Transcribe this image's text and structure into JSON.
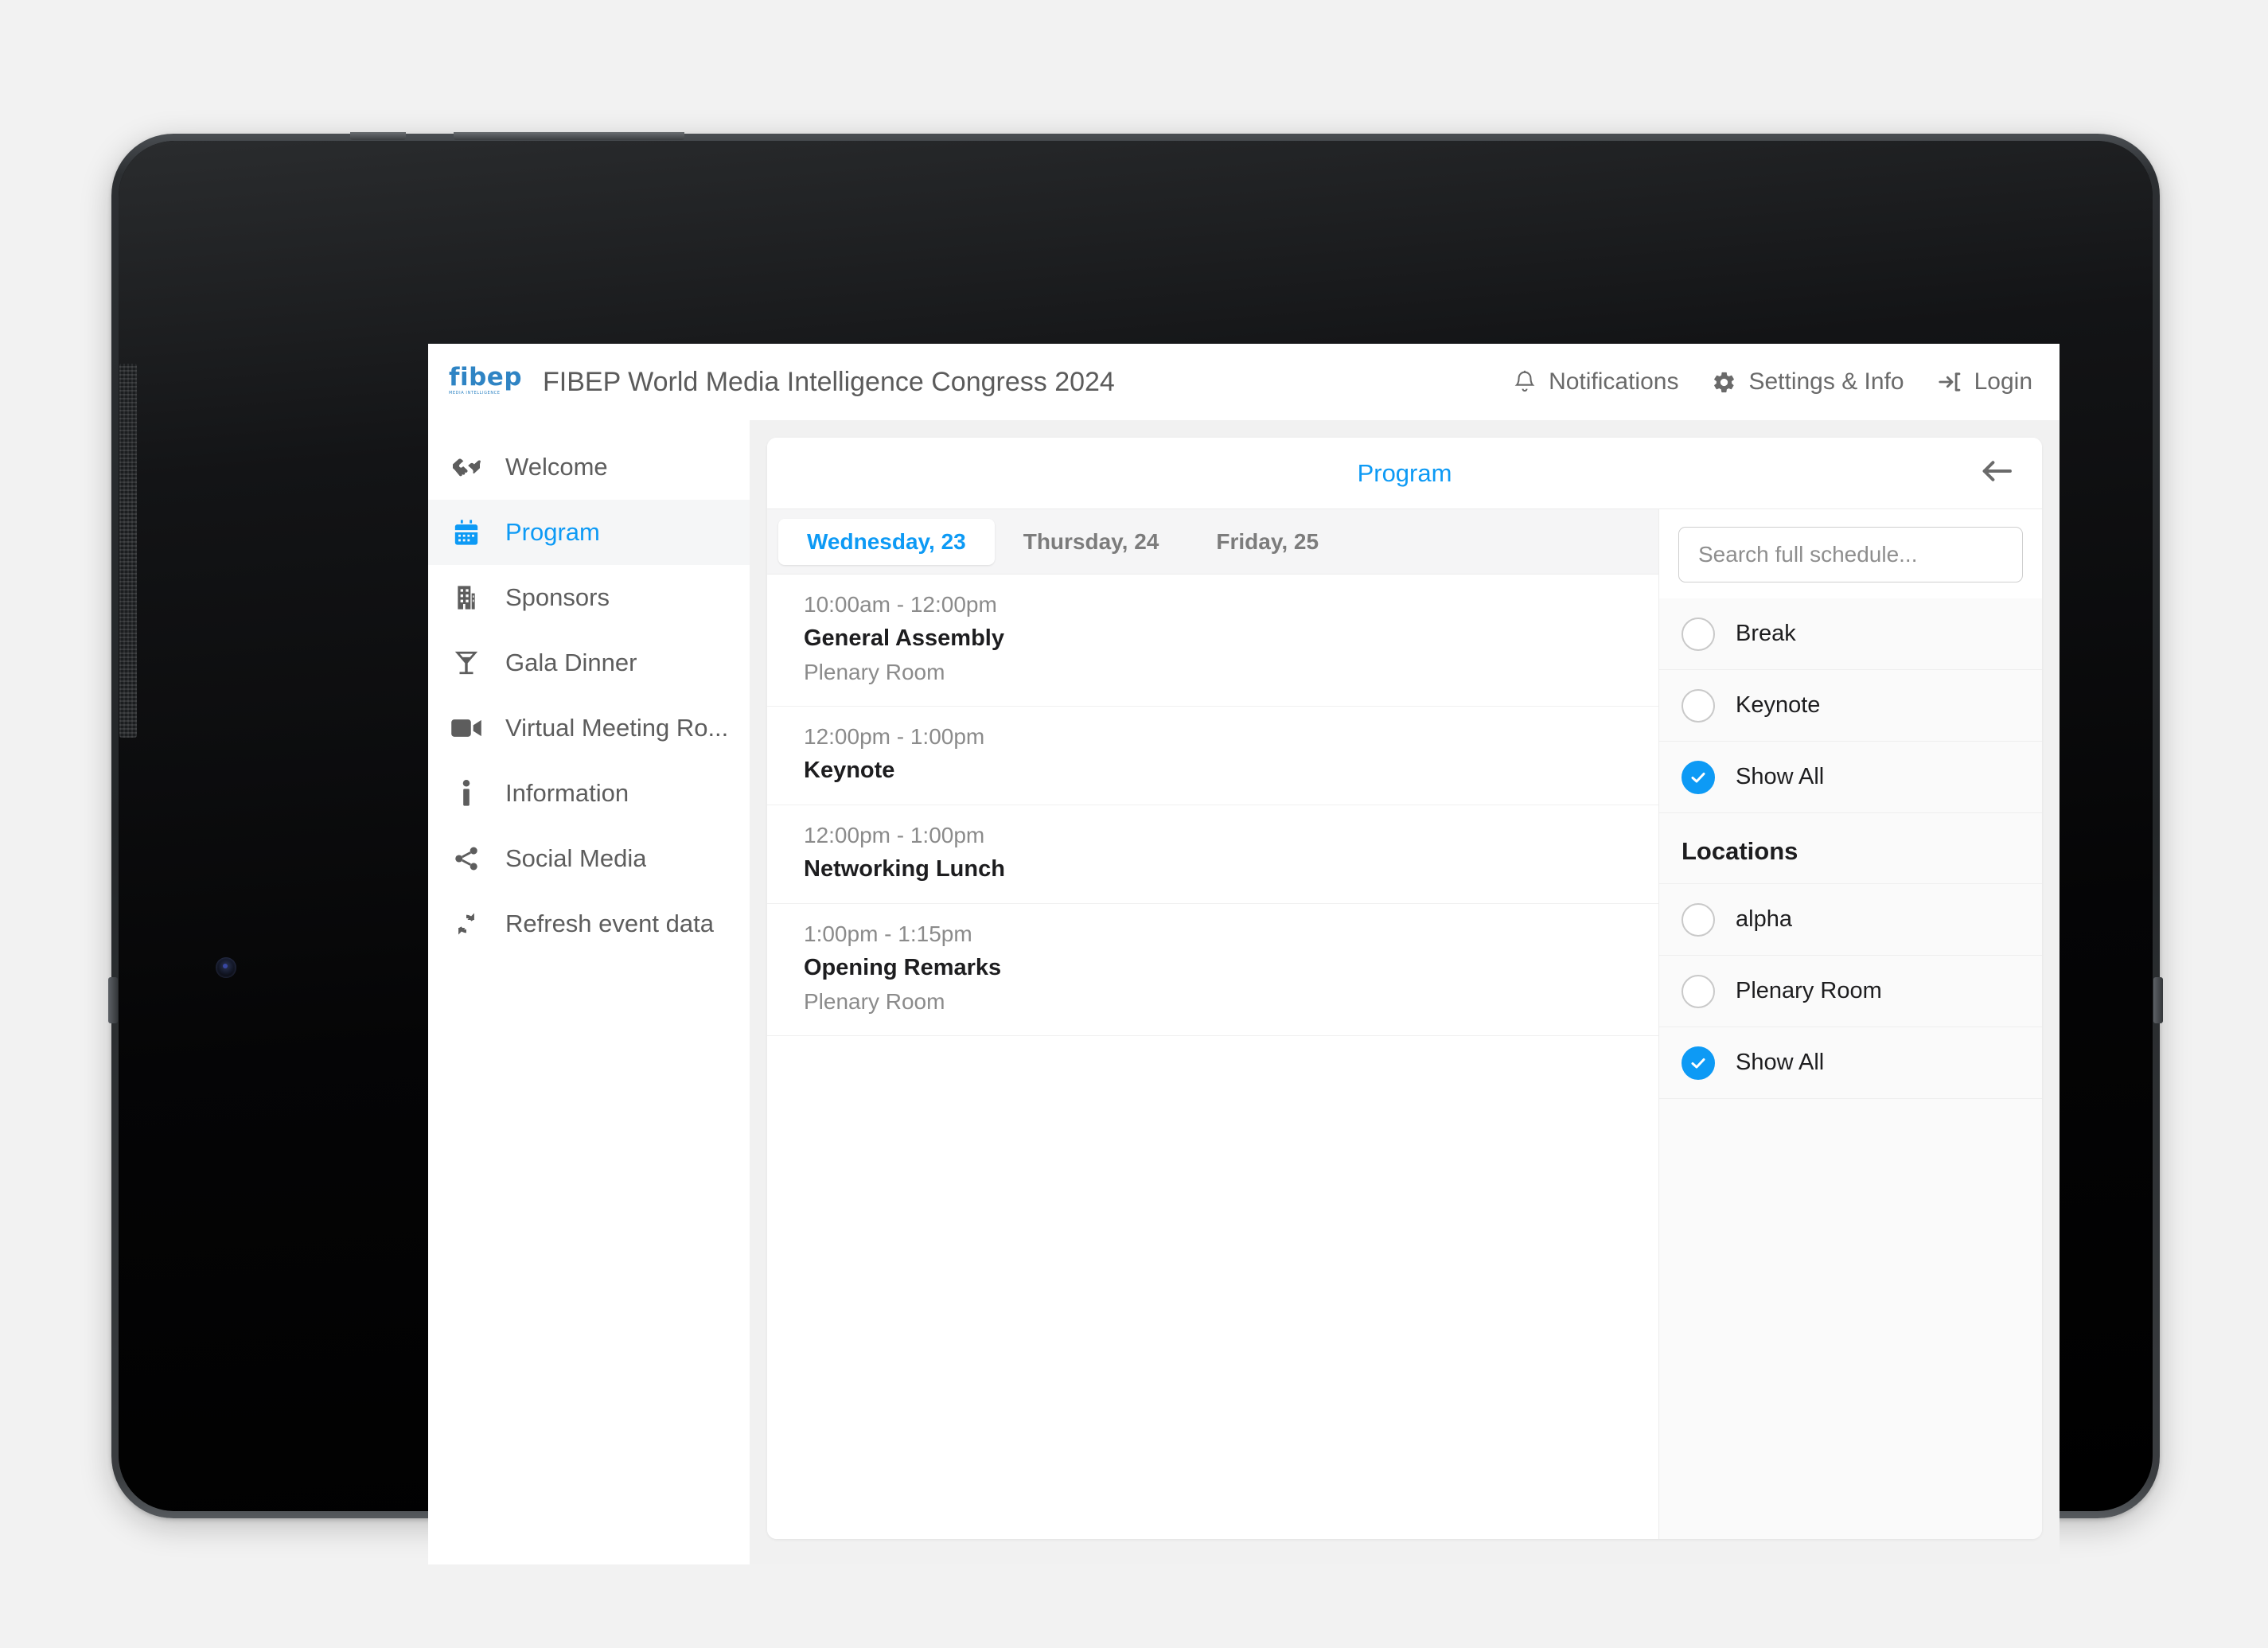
{
  "app": {
    "brand": {
      "logo_text": "fibep",
      "logo_tagline": "MEDIA INTELLIGENCE",
      "logo_color": "#2f84c4"
    },
    "title": "FIBEP World Media Intelligence Congress 2024",
    "accent_color": "#0d9af5"
  },
  "header_actions": [
    {
      "label": "Notifications",
      "icon": "bell-icon"
    },
    {
      "label": "Settings & Info",
      "icon": "gear-icon"
    },
    {
      "label": "Login",
      "icon": "login-arrow-icon"
    }
  ],
  "sidebar": {
    "items": [
      {
        "label": "Welcome",
        "icon": "handshake-icon",
        "active": false
      },
      {
        "label": "Program",
        "icon": "calendar-icon",
        "active": true
      },
      {
        "label": "Sponsors",
        "icon": "building-icon",
        "active": false
      },
      {
        "label": "Gala Dinner",
        "icon": "cocktail-glass-icon",
        "active": false
      },
      {
        "label": "Virtual Meeting Ro...",
        "icon": "video-camera-icon",
        "active": false
      },
      {
        "label": "Information",
        "icon": "info-icon",
        "active": false
      },
      {
        "label": "Social Media",
        "icon": "share-icon",
        "active": false
      },
      {
        "label": "Refresh event data",
        "icon": "refresh-icon",
        "active": false
      }
    ]
  },
  "card": {
    "title": "Program",
    "back_icon": "arrow-left-icon"
  },
  "day_tabs": [
    {
      "label": "Wednesday, 23",
      "active": true
    },
    {
      "label": "Thursday, 24",
      "active": false
    },
    {
      "label": "Friday, 25",
      "active": false
    }
  ],
  "sessions": [
    {
      "time": "10:00am - 12:00pm",
      "name": "General Assembly",
      "location": "Plenary Room"
    },
    {
      "time": "12:00pm - 1:00pm",
      "name": "Keynote",
      "location": ""
    },
    {
      "time": "12:00pm - 1:00pm",
      "name": "Networking Lunch",
      "location": ""
    },
    {
      "time": "1:00pm - 1:15pm",
      "name": "Opening Remarks",
      "location": "Plenary Room"
    }
  ],
  "search": {
    "placeholder": "Search full schedule...",
    "value": ""
  },
  "filters": {
    "types": [
      {
        "label": "Break",
        "checked": false
      },
      {
        "label": "Keynote",
        "checked": false
      },
      {
        "label": "Show All",
        "checked": true
      }
    ],
    "locations_heading": "Locations",
    "locations": [
      {
        "label": "alpha",
        "checked": false
      },
      {
        "label": "Plenary Room",
        "checked": false
      },
      {
        "label": "Show All",
        "checked": true
      }
    ]
  }
}
